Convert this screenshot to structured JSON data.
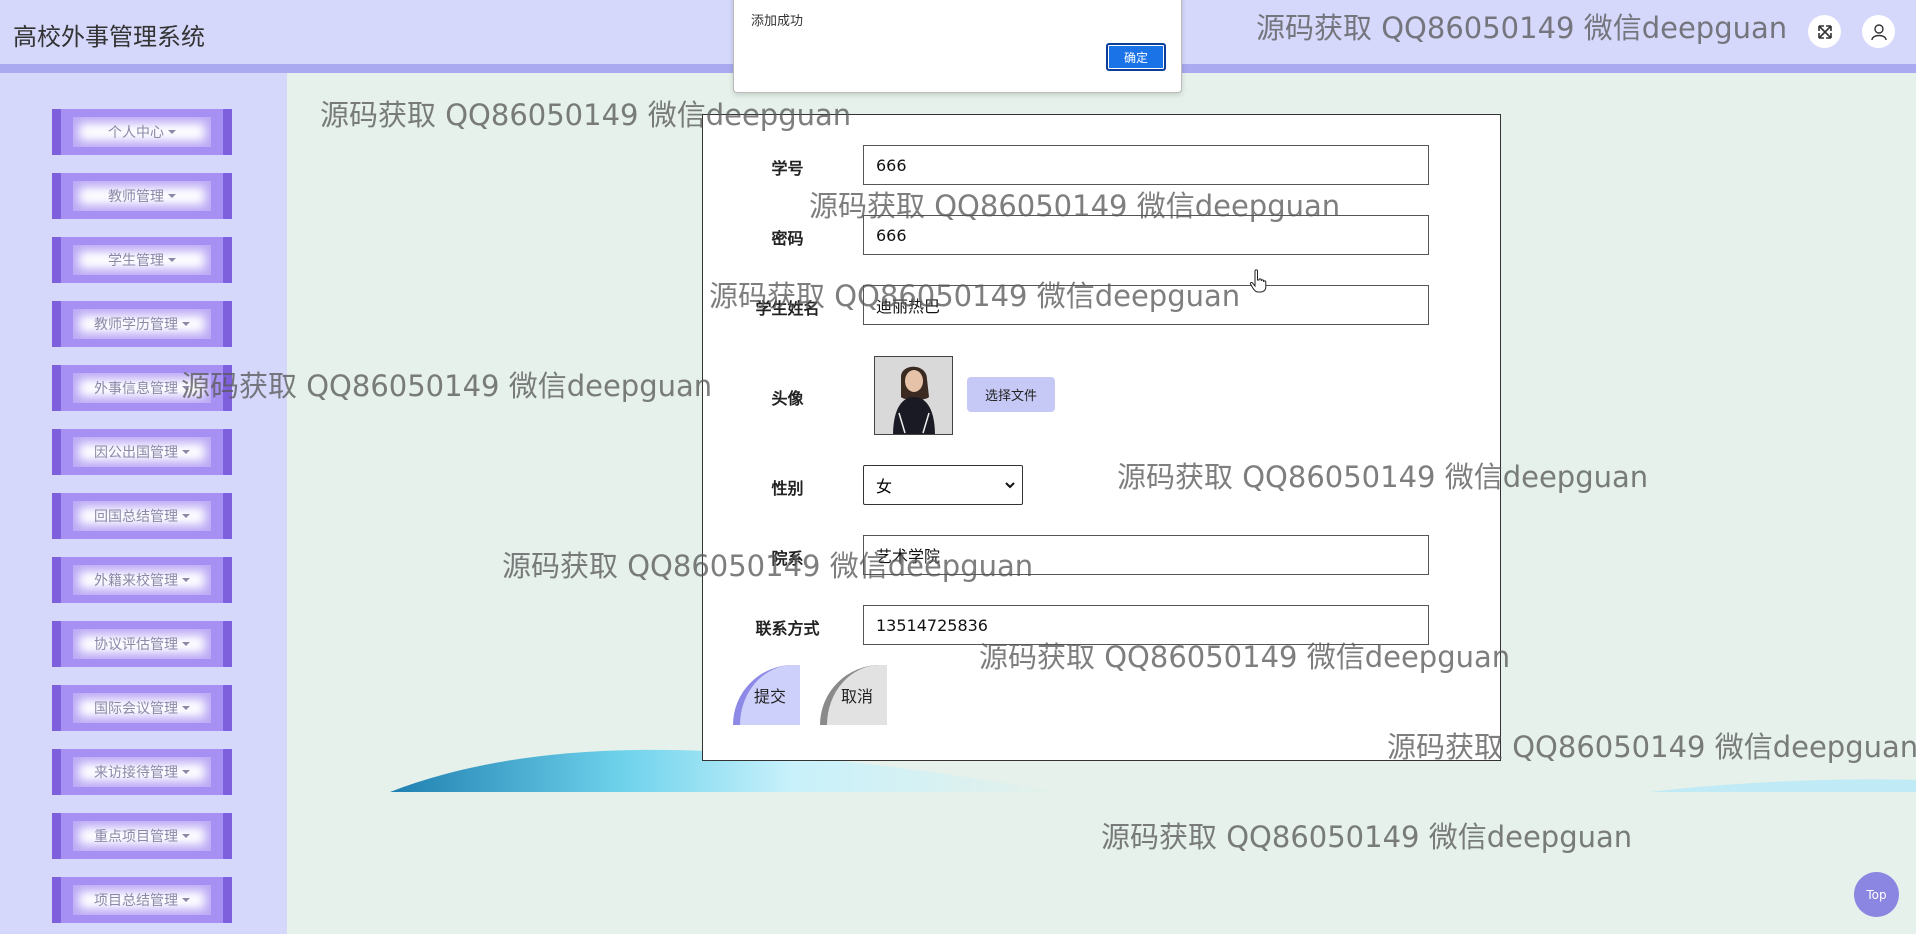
{
  "header": {
    "app_title": "高校外事管理系统",
    "icons": [
      "fullscreen-icon",
      "user-icon"
    ]
  },
  "sidebar": {
    "items": [
      {
        "label": "个人中心"
      },
      {
        "label": "教师管理"
      },
      {
        "label": "学生管理"
      },
      {
        "label": "教师学历管理"
      },
      {
        "label": "外事信息管理"
      },
      {
        "label": "因公出国管理"
      },
      {
        "label": "回国总结管理"
      },
      {
        "label": "外籍来校管理"
      },
      {
        "label": "协议评估管理"
      },
      {
        "label": "国际会议管理"
      },
      {
        "label": "来访接待管理"
      },
      {
        "label": "重点项目管理"
      },
      {
        "label": "项目总结管理"
      }
    ]
  },
  "form": {
    "student_no": {
      "label": "学号",
      "value": "666"
    },
    "password": {
      "label": "密码",
      "value": "666"
    },
    "student_name": {
      "label": "学生姓名",
      "value": "迪丽热巴"
    },
    "avatar": {
      "label": "头像",
      "choose_label": "选择文件"
    },
    "gender": {
      "label": "性别",
      "value": "女"
    },
    "department": {
      "label": "院系",
      "value": "艺术学院"
    },
    "contact": {
      "label": "联系方式",
      "value": "13514725836"
    },
    "submit_label": "提交",
    "cancel_label": "取消"
  },
  "alert": {
    "message": "添加成功",
    "ok_label": "确定"
  },
  "watermark": "源码获取 QQ86050149 微信deepguan",
  "top_button_label": "Top",
  "colors": {
    "header_bg": "#d6d8fb",
    "sidebar_bg": "#d6d8fb",
    "page_bg": "#e5f1ea",
    "menu_accent": "#7f60dc",
    "alert_ok": "#1b73e8"
  }
}
